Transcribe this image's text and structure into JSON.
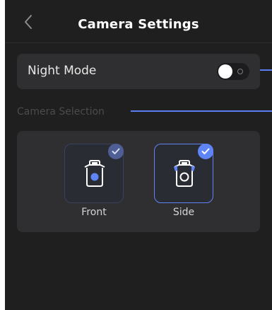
{
  "header": {
    "title": "Camera Settings",
    "back_icon": "chevron-left-icon"
  },
  "night_mode": {
    "label": "Night Mode",
    "enabled": false
  },
  "camera_selection": {
    "section_label": "Camera Selection",
    "options": [
      {
        "label": "Front",
        "selected": true,
        "icon": "front-camera-icon"
      },
      {
        "label": "Side",
        "selected": true,
        "icon": "side-camera-icon"
      }
    ]
  },
  "colors": {
    "background": "#1f1f20",
    "card": "#2f2f31",
    "accent": "#5f84f5",
    "accent_dim": "#4d5f95"
  }
}
